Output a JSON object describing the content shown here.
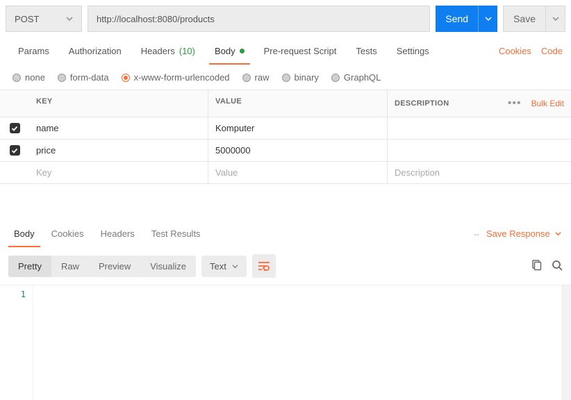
{
  "request": {
    "method": "POST",
    "url": "http://localhost:8080/products",
    "send_label": "Send",
    "save_label": "Save"
  },
  "tabs": {
    "items": [
      {
        "label": "Params",
        "active": false
      },
      {
        "label": "Authorization",
        "active": false
      },
      {
        "label": "Headers",
        "count": "(10)",
        "active": false
      },
      {
        "label": "Body",
        "active": true,
        "dirty": true
      },
      {
        "label": "Pre-request Script",
        "active": false
      },
      {
        "label": "Tests",
        "active": false
      },
      {
        "label": "Settings",
        "active": false
      }
    ],
    "cookies_label": "Cookies",
    "code_label": "Code"
  },
  "body_types": {
    "options": [
      "none",
      "form-data",
      "x-www-form-urlencoded",
      "raw",
      "binary",
      "GraphQL"
    ],
    "selected": "x-www-form-urlencoded"
  },
  "kv": {
    "head_key": "KEY",
    "head_value": "VALUE",
    "head_desc": "DESCRIPTION",
    "bulk_label": "Bulk Edit",
    "rows": [
      {
        "checked": true,
        "key": "name",
        "value": "Komputer",
        "desc": ""
      },
      {
        "checked": true,
        "key": "price",
        "value": "5000000",
        "desc": ""
      }
    ],
    "placeholder_key": "Key",
    "placeholder_value": "Value",
    "placeholder_desc": "Description"
  },
  "response": {
    "tabs": [
      "Body",
      "Cookies",
      "Headers",
      "Test Results"
    ],
    "active_tab": "Body",
    "status_placeholder": "--",
    "save_label": "Save Response",
    "view_modes": [
      "Pretty",
      "Raw",
      "Preview",
      "Visualize"
    ],
    "active_view": "Pretty",
    "lang": "Text",
    "line_number": "1"
  },
  "colors": {
    "accent": "#ff6c37",
    "primary": "#0f7ef1"
  }
}
